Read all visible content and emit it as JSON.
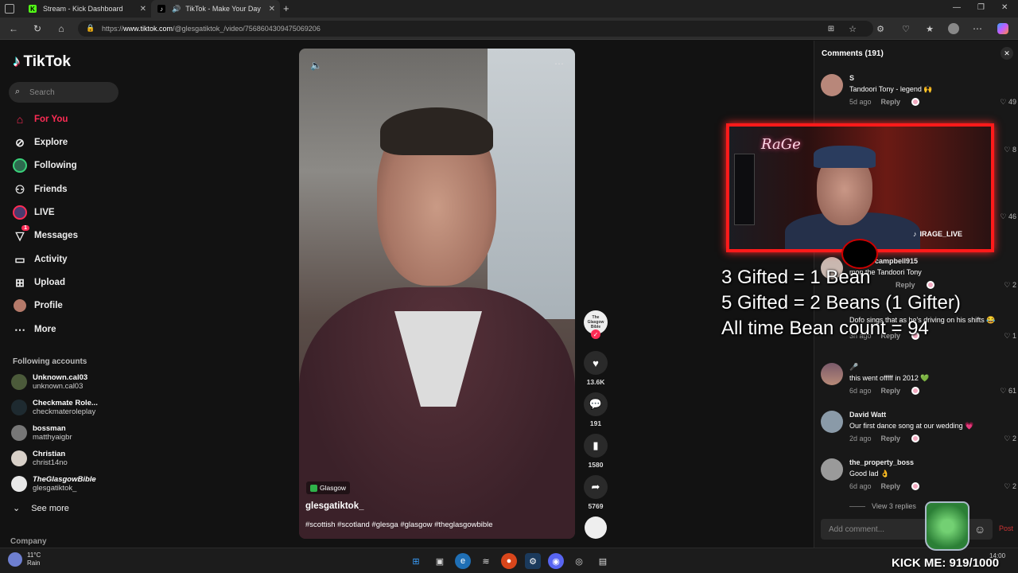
{
  "browser": {
    "tabs": [
      {
        "title": "Stream - Kick Dashboard",
        "icon": "kick-icon"
      },
      {
        "title": "TikTok - Make Your Day",
        "icon": "tiktok-icon"
      }
    ],
    "url_prefix": "https://",
    "url_domain": "www.tiktok.com",
    "url_path": "/@glesgatiktok_/video/7568604309475069206"
  },
  "sidebar": {
    "logo": "TikTok",
    "search_placeholder": "Search",
    "nav": [
      {
        "label": "For You",
        "icon": "home-icon",
        "active": true
      },
      {
        "label": "Explore",
        "icon": "compass-icon"
      },
      {
        "label": "Following",
        "icon": "following-icon"
      },
      {
        "label": "Friends",
        "icon": "friends-icon"
      },
      {
        "label": "LIVE",
        "icon": "live-icon"
      },
      {
        "label": "Messages",
        "icon": "messages-icon",
        "badge": "1"
      },
      {
        "label": "Activity",
        "icon": "activity-icon"
      },
      {
        "label": "Upload",
        "icon": "upload-icon"
      },
      {
        "label": "Profile",
        "icon": "profile-icon"
      },
      {
        "label": "More",
        "icon": "more-icon"
      }
    ],
    "following_header": "Following accounts",
    "following": [
      {
        "name": "Unknown.cal03",
        "handle": "unknown.cal03"
      },
      {
        "name": "Checkmate Role...",
        "handle": "checkmateroleplay"
      },
      {
        "name": "bossman",
        "handle": "matthyaigbr"
      },
      {
        "name": "Christian",
        "handle": "christ14no"
      },
      {
        "name": "TheGlasgowBible",
        "handle": "glesgatiktok_"
      }
    ],
    "see_more": "See more",
    "company": "Company"
  },
  "video": {
    "location": "Glasgow",
    "author": "glesgatiktok_",
    "tags": "#scottish #scotland #glesga #glasgow #theglasgowbible",
    "likes": "13.6K",
    "comments": "191",
    "saves": "1580",
    "shares": "5769",
    "avatar_text": "The Glasgow Bible"
  },
  "comments": {
    "title": "Comments (191)",
    "items": [
      {
        "user": "S",
        "text": "Tandoori Tony - legend 🙌",
        "age": "5d ago",
        "likes": "49"
      },
      {
        "user": "",
        "text": "",
        "age": "",
        "likes": "8"
      },
      {
        "user": "",
        "text": "",
        "age": "",
        "likes": "46"
      },
      {
        "user": "campbell915",
        "text": "mon the Tandoori Tony",
        "age": "",
        "likes": "2"
      },
      {
        "user": "",
        "text": "Dofo sings that as he's driving on his shifts 😂",
        "age": "3h ago",
        "likes": "1"
      },
      {
        "user": "🎤",
        "text": "this went offfff in 2012 💚",
        "age": "6d ago",
        "likes": "61"
      },
      {
        "user": "David Watt",
        "text": "Our first dance song at our wedding 💗",
        "age": "2d ago",
        "likes": "2"
      },
      {
        "user": "the_property_boss",
        "text": "Good lad 👌",
        "age": "6d ago",
        "likes": "2"
      }
    ],
    "reply_label": "Reply",
    "view_replies": "View 3 replies",
    "add_placeholder": "Add comment...",
    "post": "Post"
  },
  "overlay": {
    "streamer_handle": "IRAGE_LIVE",
    "neon_sign": "RaGe",
    "bean_lines": [
      "3 Gifted = 1 Bean",
      "5 Gifted = 2 Beans  (1 Gifter)",
      "All time Bean count = 94"
    ],
    "kick_goal": "KICK ME: 919/1000"
  },
  "taskbar": {
    "temp": "11°C",
    "weather": "Rain",
    "time": "14:00"
  }
}
